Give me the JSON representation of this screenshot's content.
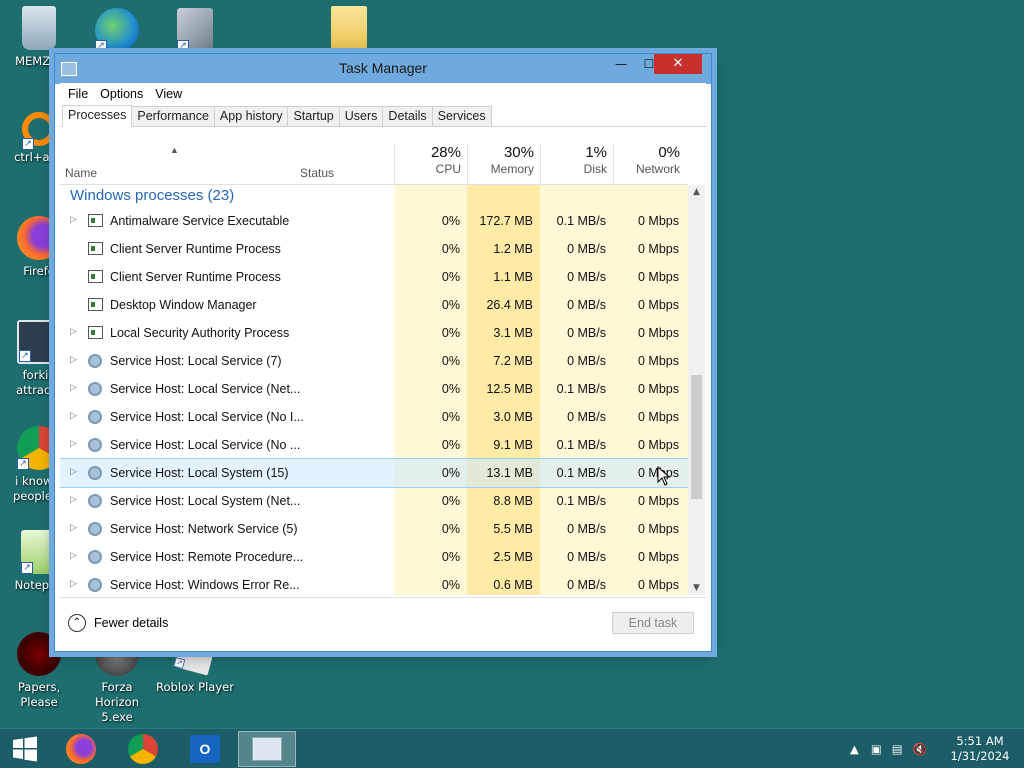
{
  "desktop": {
    "icons": [
      {
        "label": "MEMZ-D",
        "name": "recycle-bin-icon"
      },
      {
        "label": "",
        "name": "edge-icon"
      },
      {
        "label": "",
        "name": "stacked-windows-icon"
      },
      {
        "label": "",
        "name": "folder-icon"
      },
      {
        "label": "ctrl+a, e",
        "name": "orange-circle-icon"
      },
      {
        "label": "Firefo",
        "name": "firefox-icon"
      },
      {
        "label": "forkie attracta",
        "name": "settings-shortcut-icon"
      },
      {
        "label": "i know y people w",
        "name": "chrome-icon"
      },
      {
        "label": "Notepad",
        "name": "notepad-icon"
      },
      {
        "label": "Papers, Please",
        "name": "papers-please-icon"
      },
      {
        "label": "Forza Horizon 5.exe",
        "name": "forza-icon"
      },
      {
        "label": "Roblox Player",
        "name": "roblox-icon"
      }
    ]
  },
  "window": {
    "title": "Task Manager",
    "controls": {
      "minimize": "—",
      "maximize": "☐",
      "close": "✕"
    }
  },
  "menu": [
    "File",
    "Options",
    "View"
  ],
  "tabs": [
    "Processes",
    "Performance",
    "App history",
    "Startup",
    "Users",
    "Details",
    "Services"
  ],
  "columns": {
    "name": "Name",
    "status": "Status",
    "cpu": {
      "pct": "28%",
      "label": "CPU"
    },
    "memory": {
      "pct": "30%",
      "label": "Memory"
    },
    "disk": {
      "pct": "1%",
      "label": "Disk"
    },
    "network": {
      "pct": "0%",
      "label": "Network"
    }
  },
  "group_label": "Windows processes (23)",
  "rows": [
    {
      "name": "Antimalware Service Executable",
      "cpu": "0%",
      "mem": "172.7 MB",
      "disk": "0.1 MB/s",
      "net": "0 Mbps",
      "expand": true,
      "icon": "win"
    },
    {
      "name": "Client Server Runtime Process",
      "cpu": "0%",
      "mem": "1.2 MB",
      "disk": "0 MB/s",
      "net": "0 Mbps",
      "expand": false,
      "icon": "win"
    },
    {
      "name": "Client Server Runtime Process",
      "cpu": "0%",
      "mem": "1.1 MB",
      "disk": "0 MB/s",
      "net": "0 Mbps",
      "expand": false,
      "icon": "win"
    },
    {
      "name": "Desktop Window Manager",
      "cpu": "0%",
      "mem": "26.4 MB",
      "disk": "0 MB/s",
      "net": "0 Mbps",
      "expand": false,
      "icon": "win"
    },
    {
      "name": "Local Security Authority Process",
      "cpu": "0%",
      "mem": "3.1 MB",
      "disk": "0 MB/s",
      "net": "0 Mbps",
      "expand": true,
      "icon": "win"
    },
    {
      "name": "Service Host: Local Service (7)",
      "cpu": "0%",
      "mem": "7.2 MB",
      "disk": "0 MB/s",
      "net": "0 Mbps",
      "expand": true,
      "icon": "gear"
    },
    {
      "name": "Service Host: Local Service (Net...",
      "cpu": "0%",
      "mem": "12.5 MB",
      "disk": "0.1 MB/s",
      "net": "0 Mbps",
      "expand": true,
      "icon": "gear"
    },
    {
      "name": "Service Host: Local Service (No I...",
      "cpu": "0%",
      "mem": "3.0 MB",
      "disk": "0 MB/s",
      "net": "0 Mbps",
      "expand": true,
      "icon": "gear"
    },
    {
      "name": "Service Host: Local Service (No ...",
      "cpu": "0%",
      "mem": "9.1 MB",
      "disk": "0.1 MB/s",
      "net": "0 Mbps",
      "expand": true,
      "icon": "gear"
    },
    {
      "name": "Service Host: Local System (15)",
      "cpu": "0%",
      "mem": "13.1 MB",
      "disk": "0.1 MB/s",
      "net": "0 Mbps",
      "expand": true,
      "icon": "gear",
      "highlight": true
    },
    {
      "name": "Service Host: Local System (Net...",
      "cpu": "0%",
      "mem": "8.8 MB",
      "disk": "0.1 MB/s",
      "net": "0 Mbps",
      "expand": true,
      "icon": "gear"
    },
    {
      "name": "Service Host: Network Service (5)",
      "cpu": "0%",
      "mem": "5.5 MB",
      "disk": "0 MB/s",
      "net": "0 Mbps",
      "expand": true,
      "icon": "gear"
    },
    {
      "name": "Service Host: Remote Procedure...",
      "cpu": "0%",
      "mem": "2.5 MB",
      "disk": "0 MB/s",
      "net": "0 Mbps",
      "expand": true,
      "icon": "gear"
    },
    {
      "name": "Service Host: Windows Error Re...",
      "cpu": "0%",
      "mem": "0.6 MB",
      "disk": "0 MB/s",
      "net": "0 Mbps",
      "expand": true,
      "icon": "gear"
    }
  ],
  "footer": {
    "fewer_details": "Fewer details",
    "end_task": "End task"
  },
  "taskbar": {
    "time": "5:51 AM",
    "date": "1/31/2024"
  },
  "colors": {
    "desktop": "#1e6e70",
    "cpu_col": "#fff8d6",
    "mem_col": "#ffeaa6",
    "accent": "#2568b8"
  }
}
